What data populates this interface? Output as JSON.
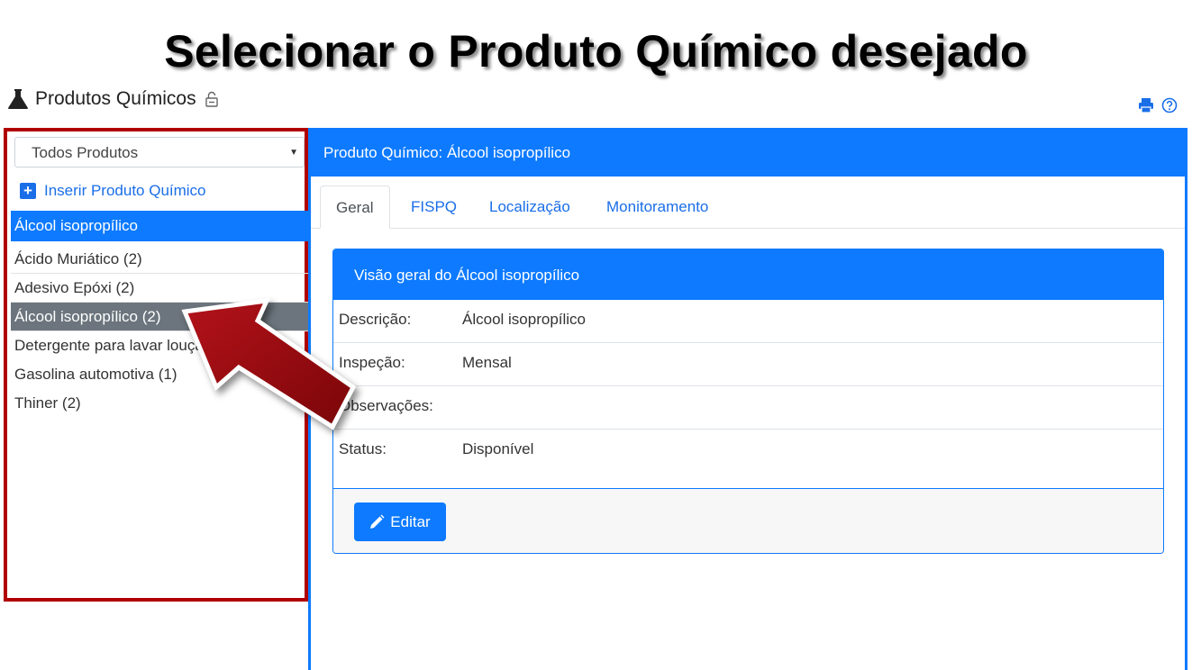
{
  "slide": {
    "title": "Selecionar o Produto Químico desejado"
  },
  "page": {
    "title": "Produtos Químicos",
    "icon": "flask-icon",
    "lock_icon": "lock-icon"
  },
  "toolbar": {
    "print_icon": "print-icon",
    "help_icon": "help-icon"
  },
  "sidebar": {
    "filter_value": "Todos Produtos",
    "insert_label": "Inserir Produto Químico",
    "selected_header": "Álcool isopropílico",
    "items": [
      {
        "label": "Ácido Muriático (2)"
      },
      {
        "label": "Adesivo Epóxi (2)"
      },
      {
        "label": "Álcool isopropílico (2)"
      },
      {
        "label": "Detergente para lavar louça (1)"
      },
      {
        "label": "Gasolina automotiva (1)"
      },
      {
        "label": "Thiner (2)"
      }
    ]
  },
  "main": {
    "panel_title": "Produto Químico: Álcool isopropílico",
    "tabs": [
      {
        "label": "Geral"
      },
      {
        "label": "FISPQ"
      },
      {
        "label": "Localização"
      },
      {
        "label": "Monitoramento"
      }
    ],
    "card": {
      "title": "Visão geral do Álcool isopropílico",
      "rows": [
        {
          "label": "Descrição:",
          "value": "Álcool isopropílico"
        },
        {
          "label": "Inspeção:",
          "value": "Mensal"
        },
        {
          "label": "Observações:",
          "value": ""
        },
        {
          "label": "Status:",
          "value": "Disponível"
        }
      ],
      "edit_label": "Editar"
    }
  },
  "colors": {
    "primary": "#0d7aff",
    "highlight_border": "#b00000",
    "arrow": "#9a0a0a",
    "active_item": "#6c757d"
  }
}
